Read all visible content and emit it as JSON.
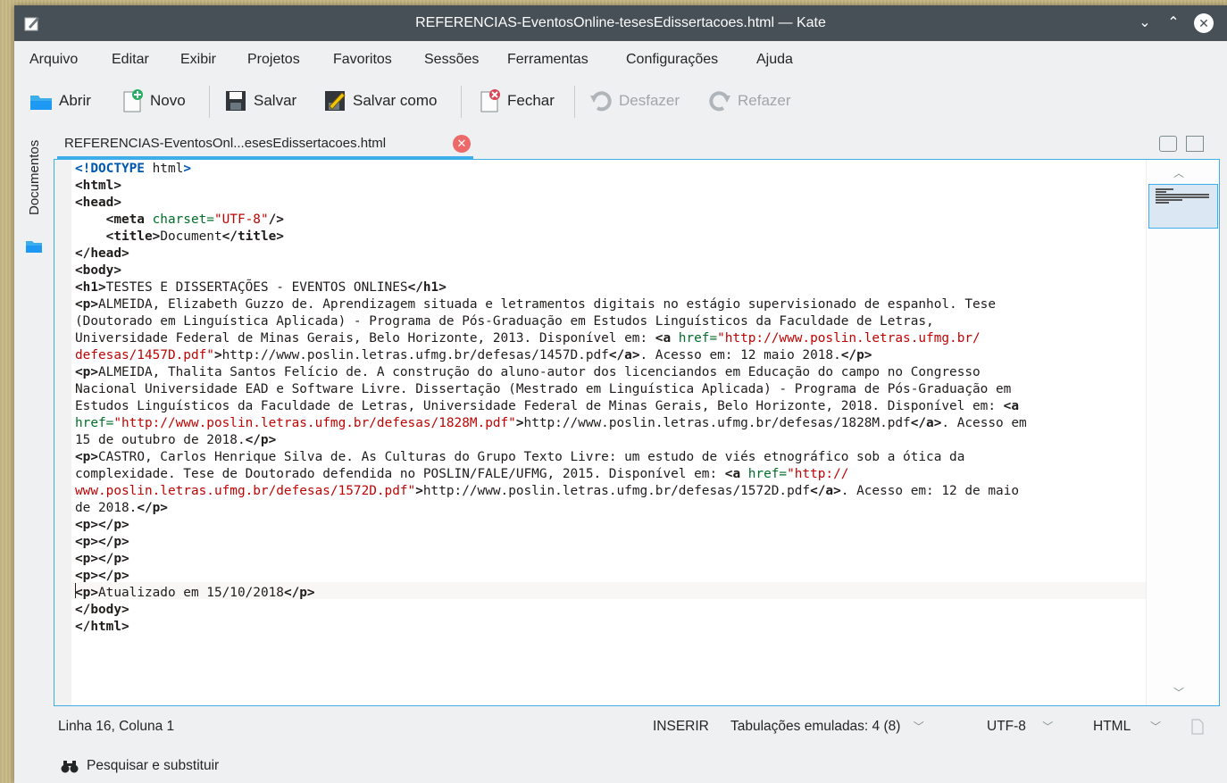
{
  "window": {
    "title": "REFERENCIAS-EventosOnline-tesesEdissertacoes.html — Kate",
    "controls": {
      "minimize": "⌄",
      "maximize": "⌃",
      "close": "✕"
    }
  },
  "menu": [
    "Arquivo",
    "Editar",
    "Exibir",
    "Projetos",
    "Favoritos",
    "Sessões",
    "Ferramentas",
    "Configurações",
    "Ajuda"
  ],
  "toolbar": {
    "open": "Abrir",
    "new": "Novo",
    "save": "Salvar",
    "save_as": "Salvar como",
    "close": "Fechar",
    "undo": "Desfazer",
    "redo": "Refazer"
  },
  "sidebar": {
    "documents_tab": "Documentos"
  },
  "tab": {
    "label": "REFERENCIAS-EventosOnl...esesEdissertacoes.html"
  },
  "status": {
    "position": "Linha 16, Coluna 1",
    "mode": "INSERIR",
    "indent": "Tabulações emuladas: 4 (8)",
    "encoding": "UTF-8",
    "syntax": "HTML"
  },
  "search": {
    "label": "Pesquisar e substituir"
  },
  "colors": {
    "accent": "#3daee9",
    "titlebar": "#475057"
  },
  "code_lines": [
    [
      [
        "kw",
        "<!DOCTYPE"
      ],
      [
        "t",
        " html"
      ],
      [
        "kw",
        ">"
      ]
    ],
    [
      [
        "tg",
        "<html>"
      ]
    ],
    [
      [
        "tg",
        "<head>"
      ]
    ],
    [
      [
        "t",
        "    "
      ],
      [
        "tg",
        "<meta"
      ],
      [
        "at",
        " charset="
      ],
      [
        "st",
        "\"UTF-8\""
      ],
      [
        "tg",
        "/>"
      ]
    ],
    [
      [
        "t",
        "    "
      ],
      [
        "tg",
        "<title>"
      ],
      [
        "t",
        "Document"
      ],
      [
        "tg",
        "</title>"
      ]
    ],
    [
      [
        "tg",
        "</head>"
      ]
    ],
    [
      [
        "tg",
        "<body>"
      ]
    ],
    [
      [
        "tg",
        "<h1>"
      ],
      [
        "t",
        "TESTES E DISSERTAÇÕES - EVENTOS ONLINES"
      ],
      [
        "tg",
        "</h1>"
      ]
    ],
    [
      [
        "tg",
        "<p>"
      ],
      [
        "t",
        "ALMEIDA, Elizabeth Guzzo de. Aprendizagem situada e letramentos digitais no estágio supervisionado de espanhol. Tese"
      ]
    ],
    [
      [
        "t",
        "(Doutorado em Linguística Aplicada) - Programa de Pós-Graduação em Estudos Linguísticos da Faculdade de Letras,"
      ]
    ],
    [
      [
        "t",
        "Universidade Federal de Minas Gerais, Belo Horizonte, 2013. Disponível em: "
      ],
      [
        "tg",
        "<a"
      ],
      [
        "at",
        " href="
      ],
      [
        "st",
        "\"http://www.poslin.letras.ufmg.br/"
      ]
    ],
    [
      [
        "st",
        "defesas/1457D.pdf\""
      ],
      [
        "tg",
        ">"
      ],
      [
        "t",
        "http://www.poslin.letras.ufmg.br/defesas/1457D.pdf"
      ],
      [
        "tg",
        "</a>"
      ],
      [
        "t",
        ". Acesso em: 12 maio 2018."
      ],
      [
        "tg",
        "</p>"
      ]
    ],
    [
      [
        "tg",
        "<p>"
      ],
      [
        "t",
        "ALMEIDA, Thalita Santos Felício de. A construção do aluno-autor dos licenciandos em Educação do campo no Congresso"
      ]
    ],
    [
      [
        "t",
        "Nacional Universidade EAD e Software Livre. Dissertação (Mestrado em Linguística Aplicada) - Programa de Pós-Graduação em"
      ]
    ],
    [
      [
        "t",
        "Estudos Linguísticos da Faculdade de Letras, Universidade Federal de Minas Gerais, Belo Horizonte, 2018. Disponível em: "
      ],
      [
        "tg",
        "<a"
      ]
    ],
    [
      [
        "at",
        "href="
      ],
      [
        "st",
        "\"http://www.poslin.letras.ufmg.br/defesas/1828M.pdf\""
      ],
      [
        "tg",
        ">"
      ],
      [
        "t",
        "http://www.poslin.letras.ufmg.br/defesas/1828M.pdf"
      ],
      [
        "tg",
        "</a>"
      ],
      [
        "t",
        ". Acesso em"
      ]
    ],
    [
      [
        "t",
        "15 de outubro de 2018."
      ],
      [
        "tg",
        "</p>"
      ]
    ],
    [
      [
        "tg",
        "<p>"
      ],
      [
        "t",
        "CASTRO, Carlos Henrique Silva de. As Culturas do Grupo Texto Livre: um estudo de viés etnográfico sob a ótica da"
      ]
    ],
    [
      [
        "t",
        "complexidade. Tese de Doutorado defendida no POSLIN/FALE/UFMG, 2015. Disponível em: "
      ],
      [
        "tg",
        "<a"
      ],
      [
        "at",
        " href="
      ],
      [
        "st",
        "\"http://"
      ]
    ],
    [
      [
        "st",
        "www.poslin.letras.ufmg.br/defesas/1572D.pdf\""
      ],
      [
        "tg",
        ">"
      ],
      [
        "t",
        "http://www.poslin.letras.ufmg.br/defesas/1572D.pdf"
      ],
      [
        "tg",
        "</a>"
      ],
      [
        "t",
        ". Acesso em: 12 de maio"
      ]
    ],
    [
      [
        "t",
        "de 2018."
      ],
      [
        "tg",
        "</p>"
      ]
    ],
    [
      [
        "tg",
        "<p></p>"
      ]
    ],
    [
      [
        "tg",
        "<p></p>"
      ]
    ],
    [
      [
        "tg",
        "<p></p>"
      ]
    ],
    [
      [
        "tg",
        "<p></p>"
      ]
    ],
    [
      [
        "tg",
        "<p>"
      ],
      [
        "t",
        "Atualizado em 15/10/2018"
      ],
      [
        "tg",
        "</p>"
      ]
    ],
    [
      [
        "tg",
        "</body>"
      ]
    ],
    [
      [
        "tg",
        "</html>"
      ]
    ]
  ]
}
